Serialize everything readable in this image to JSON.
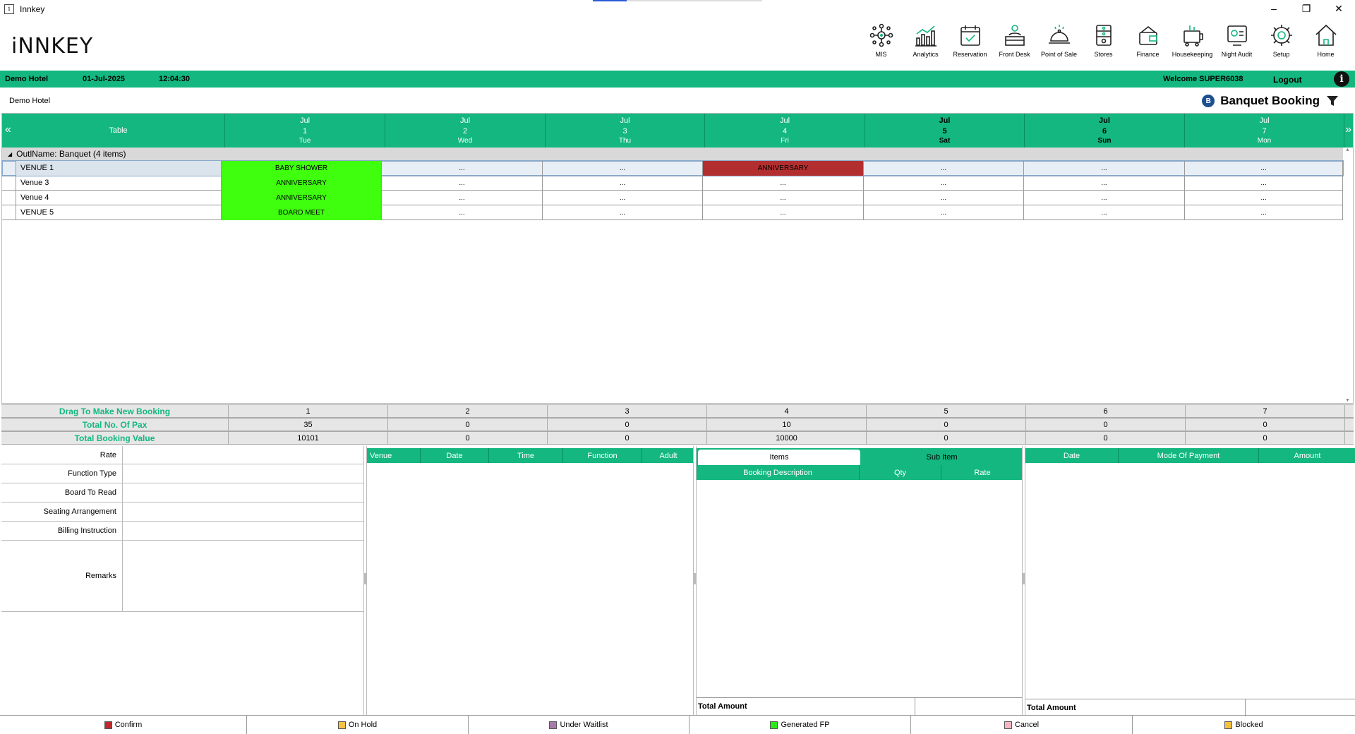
{
  "window": {
    "title": "Innkey",
    "icon": "i",
    "minimize": "–",
    "maximize": "❐",
    "close": "✕"
  },
  "logo": {
    "text": "iNNKEY"
  },
  "nav": [
    {
      "label": "MIS",
      "icon": "mis-icon"
    },
    {
      "label": "Analytics",
      "icon": "analytics-icon"
    },
    {
      "label": "Reservation",
      "icon": "reservation-icon"
    },
    {
      "label": "Front Desk",
      "icon": "front-desk-icon"
    },
    {
      "label": "Point of Sale",
      "icon": "point-of-sale-icon"
    },
    {
      "label": "Stores",
      "icon": "stores-icon"
    },
    {
      "label": "Finance",
      "icon": "finance-icon"
    },
    {
      "label": "Housekeeping",
      "icon": "housekeeping-icon"
    },
    {
      "label": "Night Audit",
      "icon": "night-audit-icon"
    },
    {
      "label": "Setup",
      "icon": "setup-icon"
    },
    {
      "label": "Home",
      "icon": "home-icon"
    }
  ],
  "status": {
    "hotel": "Demo Hotel",
    "date": "01-Jul-2025",
    "time": "12:04:30",
    "welcome": "Welcome SUPER6038",
    "logout": "Logout",
    "info": "i"
  },
  "subheader": {
    "hotel": "Demo Hotel",
    "module": "Banquet Booking",
    "module_icon": "B"
  },
  "grid": {
    "prev": "«",
    "next": "»",
    "table_header": "Table",
    "days": [
      {
        "month": "Jul",
        "day": "1",
        "dow": "Tue"
      },
      {
        "month": "Jul",
        "day": "2",
        "dow": "Wed"
      },
      {
        "month": "Jul",
        "day": "3",
        "dow": "Thu"
      },
      {
        "month": "Jul",
        "day": "4",
        "dow": "Fri"
      },
      {
        "month": "Jul",
        "day": "5",
        "dow": "Sat"
      },
      {
        "month": "Jul",
        "day": "6",
        "dow": "Sun"
      },
      {
        "month": "Jul",
        "day": "7",
        "dow": "Mon"
      }
    ],
    "group": {
      "tri": "◢",
      "label": "OutlName:  Banquet (4 items)"
    },
    "rows": [
      {
        "venue": "VENUE 1",
        "cells": [
          "BABY SHOWER",
          "...",
          "...",
          "ANNIVERSARY",
          "...",
          "...",
          "..."
        ]
      },
      {
        "venue": "Venue 3",
        "cells": [
          "ANNIVERSARY",
          "...",
          "...",
          "...",
          "...",
          "...",
          "..."
        ]
      },
      {
        "venue": "Venue 4",
        "cells": [
          "ANNIVERSARY",
          "...",
          "...",
          "...",
          "...",
          "...",
          "..."
        ]
      },
      {
        "venue": "VENUE 5",
        "cells": [
          "BOARD MEET",
          "...",
          "...",
          "...",
          "...",
          "...",
          "..."
        ]
      }
    ],
    "scroll_up": "▲",
    "scroll_down": "▼"
  },
  "summary": [
    {
      "label": "Drag To Make New Booking",
      "values": [
        "1",
        "2",
        "3",
        "4",
        "5",
        "6",
        "7"
      ]
    },
    {
      "label": "Total No. Of Pax",
      "values": [
        "35",
        "0",
        "0",
        "10",
        "0",
        "0",
        "0"
      ]
    },
    {
      "label": "Total Booking Value",
      "values": [
        "10101",
        "0",
        "0",
        "10000",
        "0",
        "0",
        "0"
      ]
    }
  ],
  "form": {
    "rate": "Rate",
    "function_type": "Function Type",
    "board_to_read": "Board To Read",
    "seating": "Seating Arrangement",
    "billing": "Billing Instruction",
    "remarks": "Remarks"
  },
  "venue_panel": {
    "columns": [
      "Venue",
      "Date",
      "Time",
      "Function",
      "Adult"
    ]
  },
  "items_panel": {
    "tabs": [
      "Items",
      "Sub Item"
    ],
    "columns": [
      "Booking Description",
      "Qty",
      "Rate"
    ],
    "total": "Total Amount"
  },
  "payment_panel": {
    "columns": [
      "Date",
      "Mode Of Payment",
      "Amount"
    ],
    "total": "Total Amount"
  },
  "legend": [
    {
      "label": "Confirm",
      "color": "#c0282d"
    },
    {
      "label": "On Hold",
      "color": "#f5c242"
    },
    {
      "label": "Under Waitlist",
      "color": "#a77ba8"
    },
    {
      "label": "Generated FP",
      "color": "#2ee81b"
    },
    {
      "label": "Cancel",
      "color": "#f4b6c2"
    },
    {
      "label": "Blocked",
      "color": "#f2c23a"
    }
  ]
}
